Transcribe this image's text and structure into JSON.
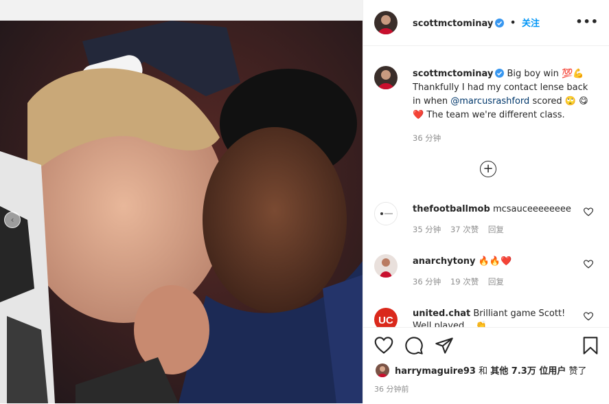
{
  "header": {
    "username": "scottmctominay",
    "dot": "•",
    "follow_label": "关注",
    "more": "•••"
  },
  "caption": {
    "username": "scottmctominay",
    "text_1": "Big boy win 💯💪",
    "text_2": "Thankfully I had my contact lense back in when",
    "mention": "@marcusrashford",
    "text_3": "scored 🙄",
    "text_4": "😋❤️ The team we're different class.",
    "time": "36 分钟"
  },
  "comments": [
    {
      "username": "thefootballmob",
      "text": "mcsauceeeeeeee",
      "time": "35 分钟",
      "likes": "37 次赞",
      "reply": "回复"
    },
    {
      "username": "anarchytony",
      "text": "🔥🔥❤️",
      "time": "36 分钟",
      "likes": "19 次赞",
      "reply": "回复"
    },
    {
      "username": "united.chat",
      "text": "Brilliant game Scott!",
      "text_2": "Well played... 👏"
    }
  ],
  "likes": {
    "user": "harrymaguire93",
    "and": "和",
    "others": "其他 7.3万 位用户",
    "liked": "赞了"
  },
  "post_time": "36 分钟前",
  "icons": {
    "like": "heart-icon",
    "comment": "comment-icon",
    "share": "share-icon",
    "save": "bookmark-icon",
    "more": "more-icon",
    "add": "plus-circle-icon",
    "prev": "chevron-left-icon"
  },
  "colors": {
    "accent": "#0095f6",
    "mention": "#00376b",
    "meta": "#8e8e8e",
    "verified": "#3897f0",
    "heart_red": "#ed4956"
  }
}
